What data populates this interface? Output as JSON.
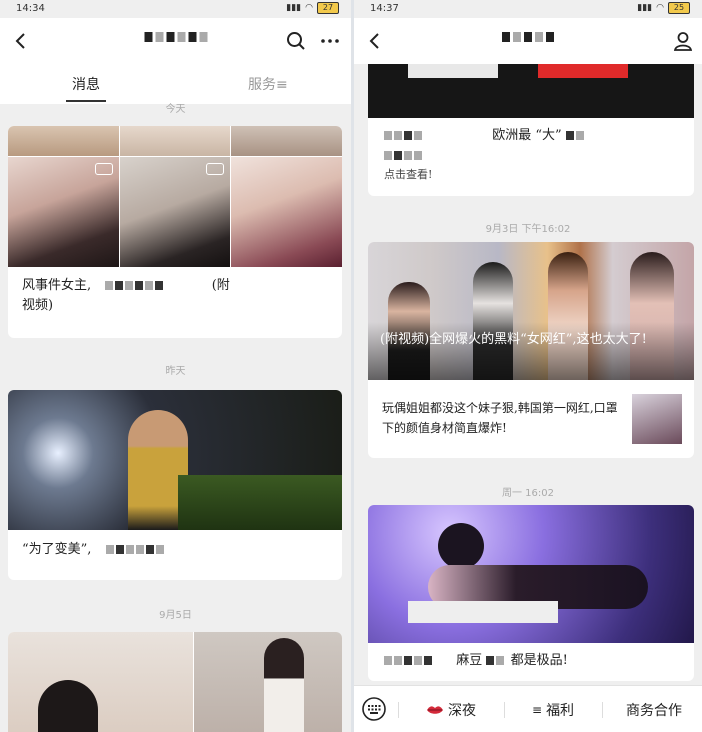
{
  "left": {
    "status": {
      "time": "14:34",
      "battery": "27"
    },
    "tabs": {
      "active": "消息",
      "inactive": "服务≡"
    },
    "dates": {
      "top_partial": "今天",
      "yesterday": "昨天",
      "sep5": "9月5日"
    },
    "cards": [
      {
        "caption_a": "风事件女主,",
        "caption_b": "(附",
        "caption_c": "视频)"
      },
      {
        "caption_a": "“为了变美”,",
        "caption_b": ""
      }
    ]
  },
  "right": {
    "status": {
      "time": "14:37",
      "battery": "25"
    },
    "top_card": {
      "text_a": "欧洲最 “大”",
      "text_b": "点击查看!"
    },
    "dates": {
      "d1": "9月3日 下午16:02",
      "d2": "周一 16:02"
    },
    "article": {
      "headline": "(附视频)全网爆火的黑料“女网红”,这也太大了!",
      "sub": "玩偶姐姐都没这个妹子狠,韩国第一网红,口罩下的颜值身材简直爆炸!"
    },
    "last_card": {
      "caption_mid": "麻豆",
      "caption_end": "都是极品!"
    },
    "bottom": {
      "item1": "深夜",
      "item2": "福利",
      "item3": "商务合作"
    }
  },
  "colors": {
    "background": "#efefef",
    "card": "#ffffff",
    "text": "#222222",
    "muted": "#aaaaaa"
  }
}
